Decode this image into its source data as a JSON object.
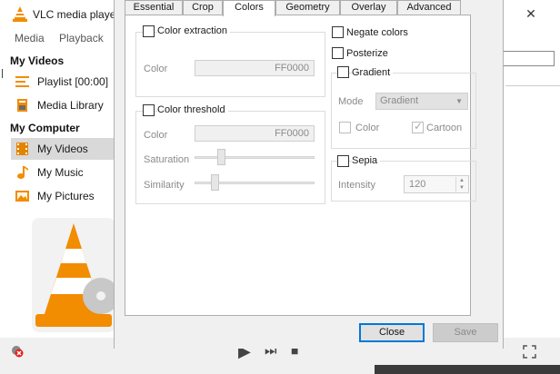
{
  "vlc": {
    "title": "VLC media player",
    "close_glyph": "✕",
    "menu": [
      "Media",
      "Playback"
    ],
    "sections": {
      "my_videos_head": "My Videos",
      "my_computer_head": "My Computer"
    },
    "items": [
      {
        "label": "Playlist [00:00]",
        "icon": "playlist-icon"
      },
      {
        "label": "Media Library",
        "icon": "media-library-icon"
      },
      {
        "label": "My Videos",
        "icon": "film-icon",
        "selected": true
      },
      {
        "label": "My Music",
        "icon": "music-note-icon"
      },
      {
        "label": "My Pictures",
        "icon": "picture-icon"
      }
    ],
    "controls": {
      "play": "▶",
      "next": "⏭",
      "stop": "■"
    }
  },
  "dialog": {
    "tabs": [
      "Essential",
      "Crop",
      "Colors",
      "Geometry",
      "Overlay",
      "Advanced"
    ],
    "active_tab": "Colors",
    "color_extraction": {
      "label": "Color extraction",
      "color_label": "Color",
      "color_value": "FF0000"
    },
    "color_threshold": {
      "label": "Color threshold",
      "color_label": "Color",
      "color_value": "FF0000",
      "saturation_label": "Saturation",
      "similarity_label": "Similarity"
    },
    "negate_colors": "Negate colors",
    "posterize": "Posterize",
    "gradient": {
      "label": "Gradient",
      "mode_label": "Mode",
      "mode_value": "Gradient",
      "color_label": "Color",
      "cartoon_label": "Cartoon"
    },
    "sepia": {
      "label": "Sepia",
      "intensity_label": "Intensity",
      "intensity_value": "120"
    },
    "buttons": {
      "close": "Close",
      "save": "Save"
    }
  },
  "colors": {
    "accent": "#0078d7",
    "vlc_orange": "#f28c00"
  }
}
